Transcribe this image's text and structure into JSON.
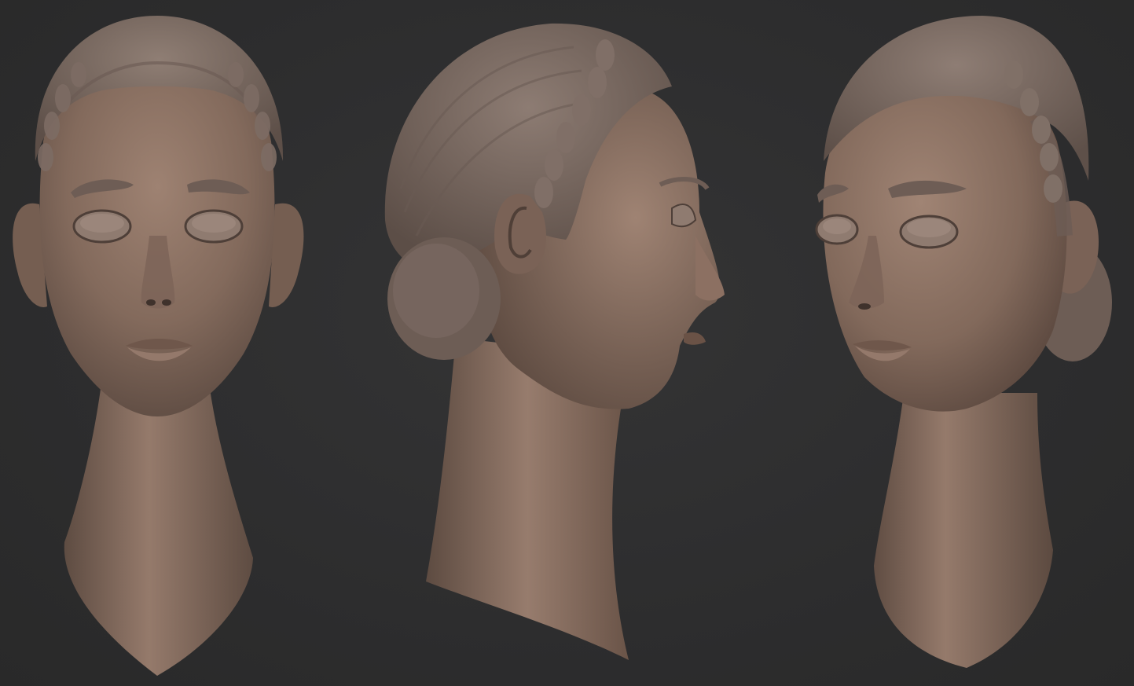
{
  "scene": {
    "background": "#2e2e2f",
    "skin_color": "#8a7163",
    "hair_color": "#7a6a62",
    "views": [
      {
        "id": "front",
        "kind": "front-view"
      },
      {
        "id": "side",
        "kind": "side-view"
      },
      {
        "id": "three-quarter",
        "kind": "three-quarter-view"
      }
    ]
  }
}
